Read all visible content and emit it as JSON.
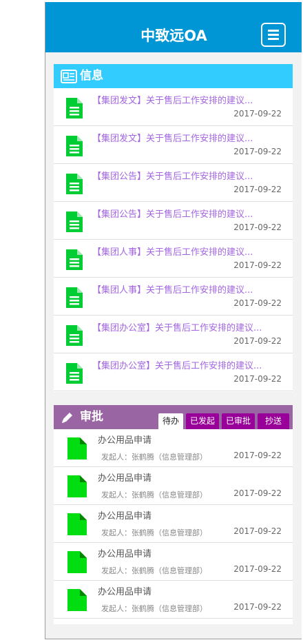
{
  "header": {
    "title": "中致远OA",
    "menu_icon": "menu-icon"
  },
  "info": {
    "title": "信息",
    "icon": "newspaper-icon",
    "items": [
      {
        "title": "【集团发文】关于售后工作安排的建议...",
        "date": "2017-09-22"
      },
      {
        "title": "【集团发文】关于售后工作安排的建议...",
        "date": "2017-09-22"
      },
      {
        "title": "【集团公告】关于售后工作安排的建议...",
        "date": "2017-09-22"
      },
      {
        "title": "【集团公告】关于售后工作安排的建议...",
        "date": "2017-09-22"
      },
      {
        "title": "【集团人事】关于售后工作安排的建议...",
        "date": "2017-09-22"
      },
      {
        "title": "【集团人事】关于售后工作安排的建议...",
        "date": "2017-09-22"
      },
      {
        "title": "【集团办公室】关于售后工作安排的建议...",
        "date": "2017-09-22"
      },
      {
        "title": "【集团办公室】关于售后工作安排的建议...",
        "date": "2017-09-22"
      }
    ]
  },
  "approval": {
    "title": "审批",
    "icon": "pencil-icon",
    "tabs": [
      "待办",
      "已发起",
      "已审批",
      "抄送"
    ],
    "active_tab": "待办",
    "items": [
      {
        "title": "办公用品申请",
        "sender": "发起人：张鹤腾（信息管理部）",
        "date": "2017-09-22"
      },
      {
        "title": "办公用品申请",
        "sender": "发起人：张鹤腾（信息管理部）",
        "date": "2017-09-22"
      },
      {
        "title": "办公用品申请",
        "sender": "发起人：张鹤腾（信息管理部）",
        "date": "2017-09-22"
      },
      {
        "title": "办公用品申请",
        "sender": "发起人：张鹤腾（信息管理部）",
        "date": "2017-09-22"
      },
      {
        "title": "办公用品申请",
        "sender": "发起人：张鹤腾（信息管理部）",
        "date": "2017-09-22"
      }
    ]
  },
  "colors": {
    "header": "#0095d4",
    "info_header": "#33ccff",
    "approval_header": "#9966a3",
    "tab": "#990099",
    "info_title": "#a366e0",
    "doc_icon_info": "#00cc33",
    "doc_icon_approval": "#00dd11"
  }
}
